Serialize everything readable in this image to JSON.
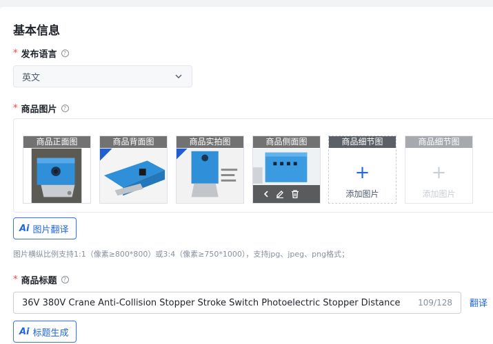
{
  "section": {
    "title": "基本信息"
  },
  "language": {
    "required_mark": "*",
    "label": "发布语言",
    "help": "?",
    "value": "英文"
  },
  "images": {
    "required_mark": "*",
    "label": "商品图片",
    "help": "?",
    "slots": [
      {
        "caption": "商品正面图"
      },
      {
        "caption": "商品背面图"
      },
      {
        "caption": "商品实拍图"
      },
      {
        "caption": "商品侧面图"
      },
      {
        "caption": "商品细节图",
        "add_label": "添加图片"
      },
      {
        "caption": "商品细节图",
        "add_label": "添加图片"
      }
    ],
    "translate_button": {
      "ai": "Ai",
      "label": "图片翻译"
    },
    "hint": "图片横纵比例支持1:1（像素≥800*800）或3:4（像素≥750*1000），支持jpg、jpeg、png格式；"
  },
  "product_title": {
    "required_mark": "*",
    "label": "商品标题",
    "help": "?",
    "value": "36V 380V Crane Anti-Collision Stopper Stroke Switch Photoelectric Stopper Distance",
    "count": "109/128",
    "translate_link": "翻译",
    "generate_button": {
      "ai": "Ai",
      "label": "标题生成"
    }
  },
  "colors": {
    "accent": "#1f66d9",
    "required": "#f53f3f",
    "product_blue": "#2f8fd8"
  }
}
